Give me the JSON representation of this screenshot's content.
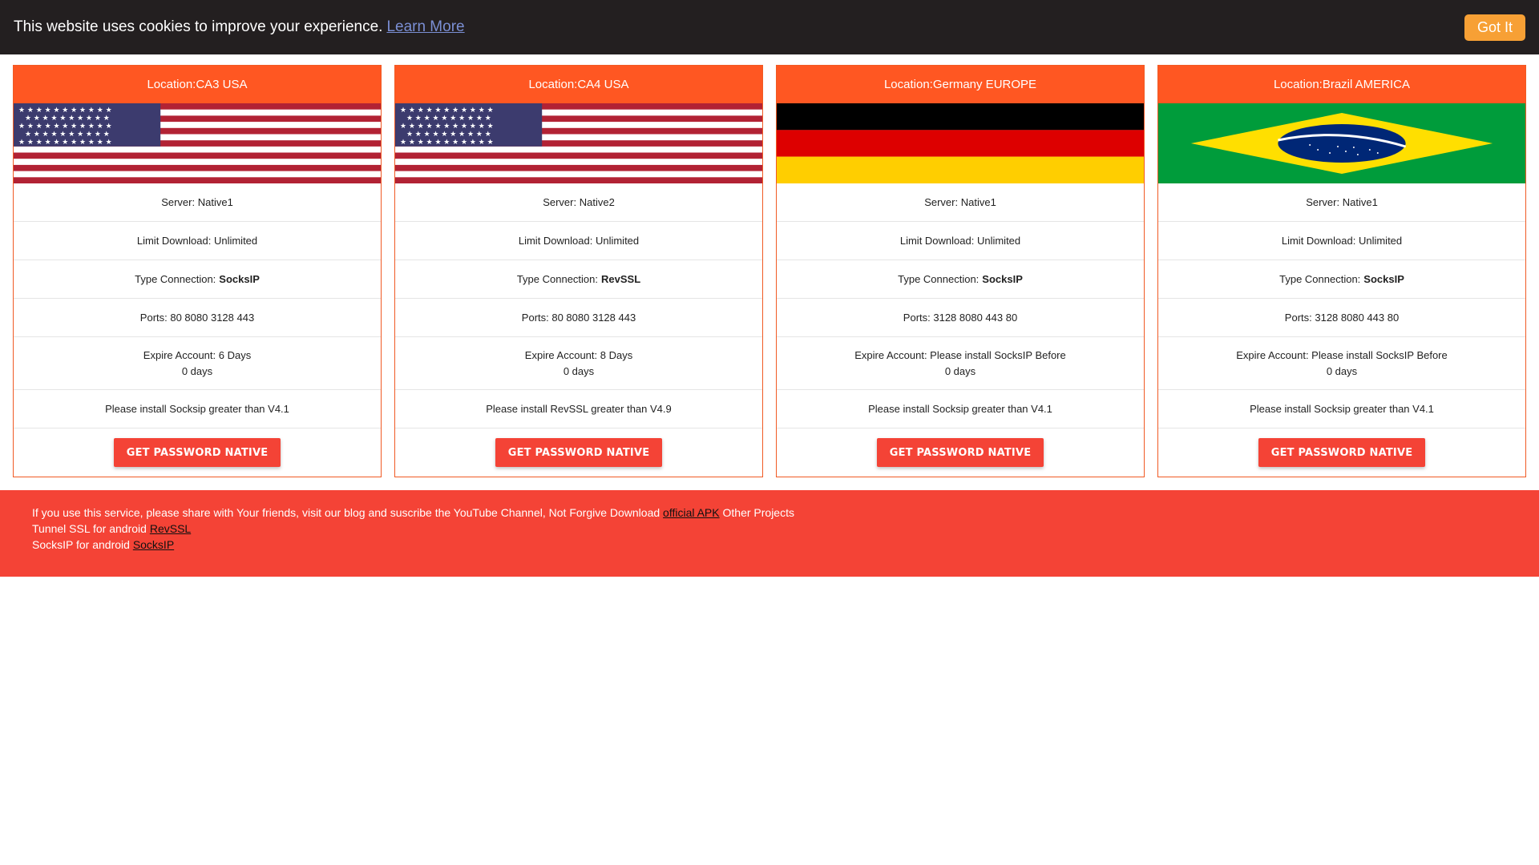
{
  "cookie_bar": {
    "text": "This website uses cookies to improve your experience.",
    "learn_more": "Learn More",
    "got_it": "Got It",
    "background": "#231f20",
    "button_color": "#f7a035"
  },
  "cards": [
    {
      "location": "Location:CA3 USA",
      "flag": "usa-flag",
      "server": "Server: Native1",
      "limit": "Limit Download: Unlimited",
      "type_label": "Type Connection:",
      "type_value": "SocksIP",
      "ports": "Ports: 80 8080 3128 443",
      "expire": "Expire Account: 6 Days",
      "expire_days": "0 days",
      "install": "Please install Socksip greater than V4.1",
      "button": "GET PASSWORD NATIVE"
    },
    {
      "location": "Location:CA4 USA",
      "flag": "usa-flag",
      "server": "Server: Native2",
      "limit": "Limit Download: Unlimited",
      "type_label": "Type Connection:",
      "type_value": "RevSSL",
      "ports": "Ports: 80 8080 3128 443",
      "expire": "Expire Account: 8 Days",
      "expire_days": "0 days",
      "install": "Please install RevSSL greater than V4.9",
      "button": "GET PASSWORD NATIVE"
    },
    {
      "location": "Location:Germany EUROPE",
      "flag": "germany-flag",
      "server": "Server: Native1",
      "limit": "Limit Download: Unlimited",
      "type_label": "Type Connection:",
      "type_value": "SocksIP",
      "ports": "Ports: 3128 8080 443 80",
      "expire": "Expire Account: Please install SocksIP Before",
      "expire_days": "0 days",
      "install": "Please install Socksip greater than V4.1",
      "button": "GET PASSWORD NATIVE"
    },
    {
      "location": "Location:Brazil AMERICA",
      "flag": "brazil-flag",
      "server": "Server: Native1",
      "limit": "Limit Download: Unlimited",
      "type_label": "Type Connection:",
      "type_value": "SocksIP",
      "ports": "Ports: 3128 8080 443 80",
      "expire": "Expire Account: Please install SocksIP Before",
      "expire_days": "0 days",
      "install": "Please install Socksip greater than V4.1",
      "button": "GET PASSWORD NATIVE"
    }
  ],
  "footer": {
    "line1_text": "If you use this service, please share with Your friends, visit our blog and suscribe the YouTube Channel, Not Forgive Download",
    "line1_link": "official APK",
    "line1_suffix": "Other Projects",
    "line2_text": "Tunnel SSL for android",
    "line2_link": "RevSSL",
    "line3_text": "SocksIP for android",
    "line3_link": "SocksIP",
    "background": "#f44336"
  },
  "colors": {
    "card_header": "#ff5722",
    "card_border": "#f05a24",
    "button": "#f44336"
  }
}
